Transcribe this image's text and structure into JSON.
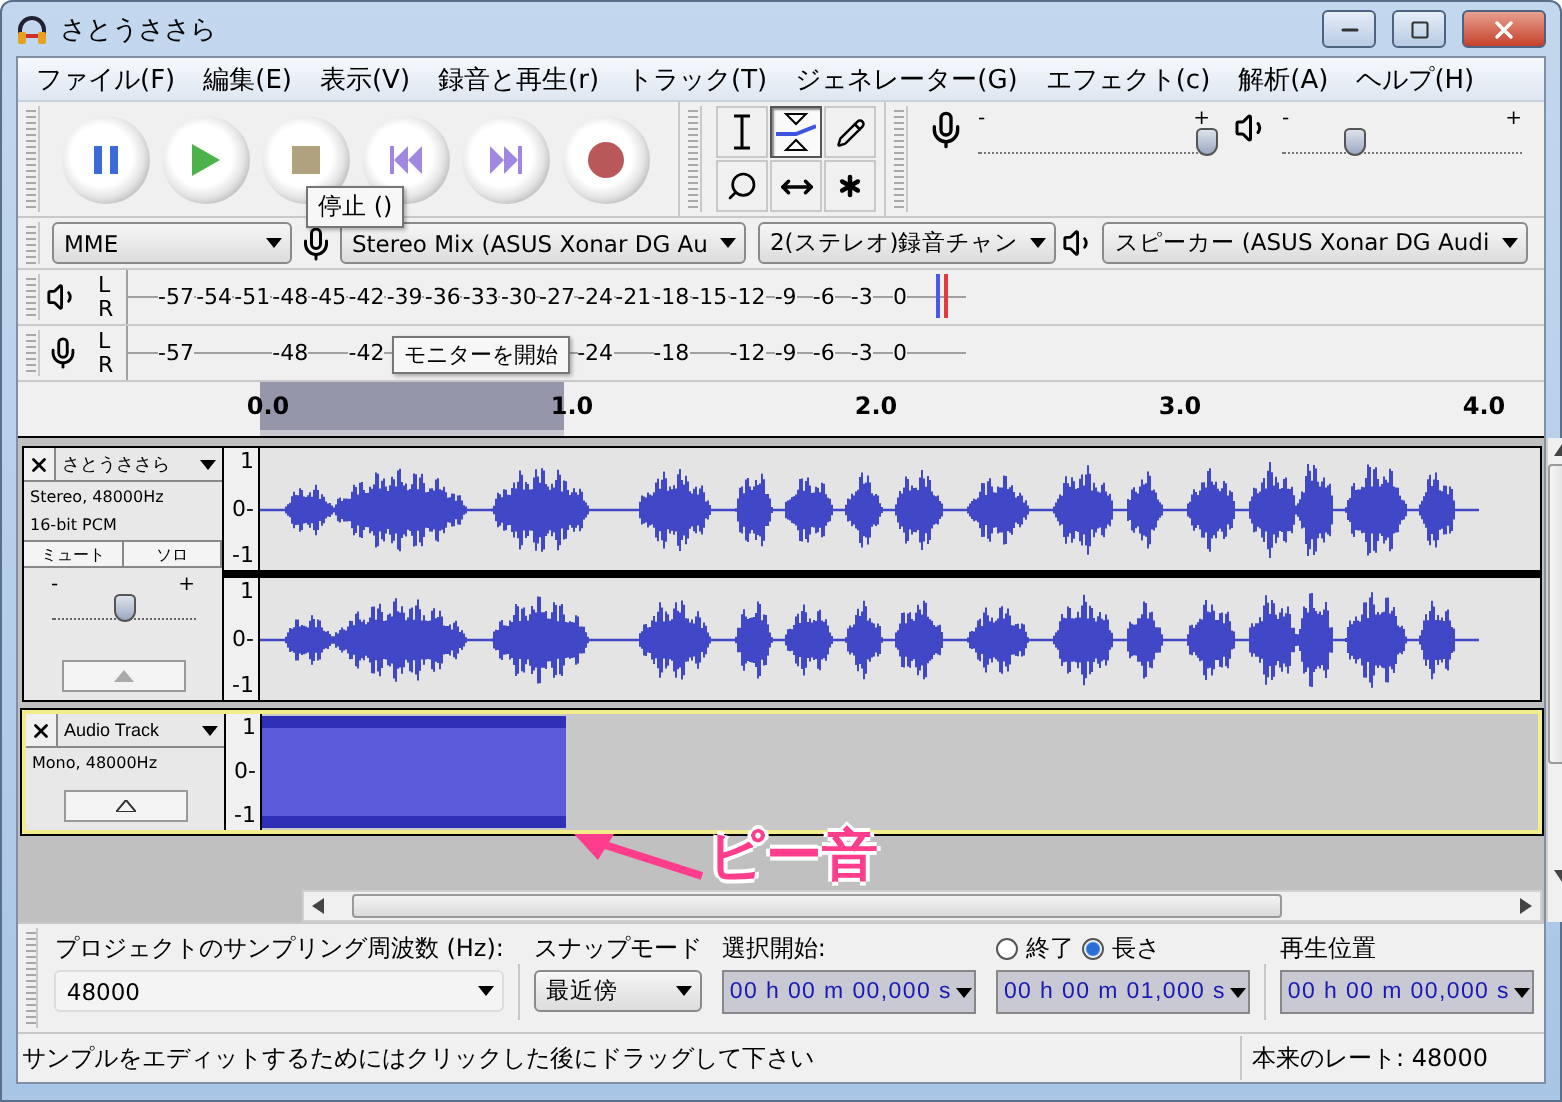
{
  "window": {
    "title": "さとうささら"
  },
  "menu": [
    "ファイル(F)",
    "編集(E)",
    "表示(V)",
    "録音と再生(r)",
    "トラック(T)",
    "ジェネレーター(G)",
    "エフェクト(c)",
    "解析(A)",
    "ヘルプ(H)"
  ],
  "transport": {
    "buttons": [
      {
        "kind": "pause"
      },
      {
        "kind": "play"
      },
      {
        "kind": "stop"
      },
      {
        "kind": "skip_start"
      },
      {
        "kind": "skip_end"
      },
      {
        "kind": "record"
      }
    ],
    "tooltip": "停止 ()"
  },
  "tools": [
    {
      "kind": "select",
      "selected": false
    },
    {
      "kind": "envelope",
      "selected": true
    },
    {
      "kind": "draw",
      "selected": false
    },
    {
      "kind": "zoom",
      "selected": false
    },
    {
      "kind": "timeshift",
      "selected": false
    },
    {
      "kind": "multi",
      "selected": false
    }
  ],
  "mixer": {
    "input": {
      "level": 0.98,
      "marks": [
        "-",
        "+"
      ]
    },
    "output": {
      "level": 0.3,
      "marks": [
        "-",
        "+"
      ]
    }
  },
  "devices": {
    "host": "MME",
    "input": "Stereo Mix (ASUS Xonar DG Au",
    "channels": "2(ステレオ)録音チャン",
    "output": "スピーカー (ASUS Xonar DG Audi"
  },
  "meters": [
    {
      "kind": "playback",
      "channels": [
        "L",
        "R"
      ],
      "labels": [
        "-57",
        "-54",
        "-51",
        "-48",
        "-45",
        "-42",
        "-39",
        "-36",
        "-33",
        "-30",
        "-27",
        "-24",
        "-21",
        "-18",
        "-15",
        "-12",
        "-9",
        "-6",
        "-3",
        "0"
      ]
    },
    {
      "kind": "record",
      "channels": [
        "L",
        "R"
      ],
      "labels": [
        "-57",
        "-48",
        "-42",
        "-24",
        "-18",
        "-12",
        "-9",
        "-6",
        "-3",
        "0"
      ],
      "tooltip": "モニターを開始"
    }
  ],
  "ruler": {
    "ticks": [
      "0.0",
      "1.0",
      "2.0",
      "3.0",
      "4.0"
    ]
  },
  "tracks": [
    {
      "kind": "stereo",
      "name": "さとうささら",
      "selected": false,
      "info": [
        "Stereo, 48000Hz",
        "16-bit PCM"
      ],
      "mute": "ミュート",
      "solo": "ソロ",
      "gain": {
        "level": 0.5,
        "marks": [
          "-",
          "+"
        ]
      },
      "channels": [
        {
          "scale": [
            "1",
            "0-",
            "-1"
          ]
        },
        {
          "scale": [
            "1",
            "0-",
            "-1"
          ]
        }
      ]
    },
    {
      "kind": "mono",
      "name": "Audio Track",
      "selected": true,
      "info": [
        "Mono, 48000Hz"
      ],
      "channels": [
        {
          "scale": [
            "1",
            "0-",
            "-1"
          ]
        }
      ]
    }
  ],
  "annotation": {
    "text": "ピー音"
  },
  "selection_bar": {
    "rate_label": "プロジェクトのサンプリング周波数 (Hz):",
    "rate": "48000",
    "snap_label": "スナップモード",
    "snap": "最近傍",
    "start_label": "選択開始:",
    "start": "00 h 00 m 00,000 s",
    "radios": [
      {
        "label": "終了",
        "selected": false
      },
      {
        "label": "長さ",
        "selected": true
      }
    ],
    "end": "00 h 00 m 01,000 s",
    "position_label": "再生位置",
    "position": "00 h 00 m 00,000 s"
  },
  "status": {
    "message": "サンプルをエディットするためにはクリックした後にドラッグして下さい",
    "rate": "本来のレート: 48000"
  }
}
